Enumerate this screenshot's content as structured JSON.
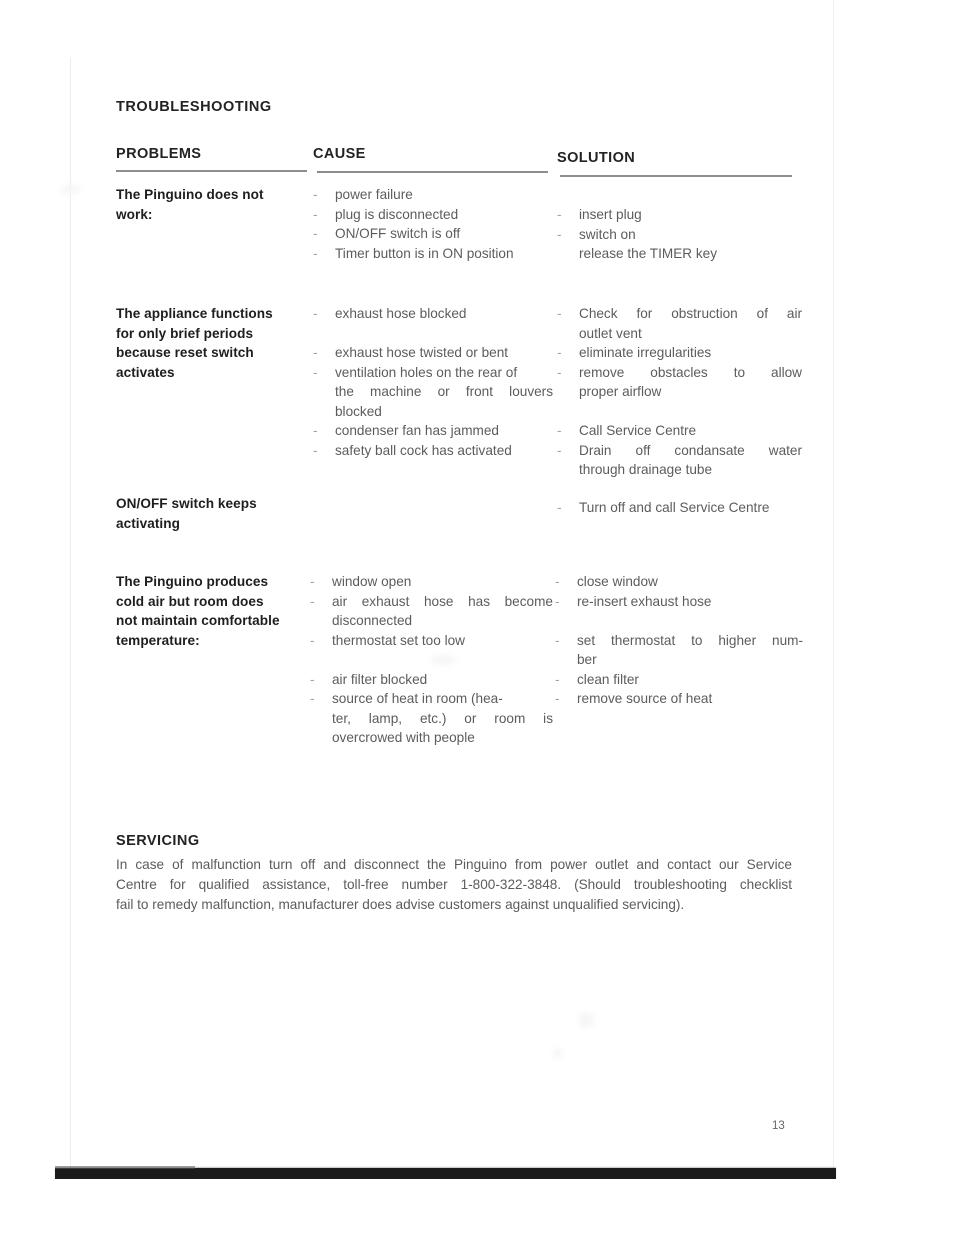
{
  "document": {
    "title": "TROUBLESHOOTING",
    "page_number": "13"
  },
  "table": {
    "headers": {
      "problems": "PROBLEMS",
      "cause": "CAUSE",
      "solution": "SOLUTION"
    },
    "rows": [
      {
        "problem": [
          "The Pinguino does not",
          "work:"
        ],
        "causes": [
          "power failure",
          "plug is disconnected",
          "ON/OFF switch is off",
          "Timer button is in ON position"
        ],
        "solutions": [
          "insert plug",
          "switch on",
          "release the TIMER key"
        ]
      },
      {
        "problem": [
          "The appliance functions",
          "for only brief periods",
          "because reset switch",
          "activates"
        ],
        "causes": [
          "exhaust hose blocked",
          "exhaust hose twisted or bent",
          "ventilation holes on the rear of",
          "the machine or front louvers",
          "blocked",
          "condenser fan has jammed",
          "safety ball cock has activated"
        ],
        "solutions": [
          "Check for obstruction of air",
          "outlet vent",
          "eliminate irregularities",
          "remove obstacles to allow",
          "proper airflow",
          "Call Service Centre",
          "Drain off condansate water",
          "through drainage tube"
        ]
      },
      {
        "problem": [
          "ON/OFF switch keeps",
          "activating"
        ],
        "causes": [],
        "solutions": [
          "Turn off and call Service Centre"
        ]
      },
      {
        "problem": [
          "The Pinguino produces",
          "cold air but room does",
          "not maintain comfortable",
          "temperature:"
        ],
        "causes": [
          "window open",
          "air exhaust hose has become",
          "disconnected",
          "thermostat set too low",
          "air filter blocked",
          "source of heat in room (hea-",
          "ter, lamp, etc.) or room is",
          "overcrowed with people"
        ],
        "solutions": [
          "close window",
          "re-insert exhaust hose",
          "set thermostat to higher num-",
          "ber",
          "clean filter",
          "remove source of heat"
        ]
      }
    ]
  },
  "servicing": {
    "title": "SERVICING",
    "lines": [
      "In case of malfunction turn off and disconnect the Pinguino from power outlet and contact our Service",
      "Centre for qualified assistance, toll-free number 1-800-322-3848. (Should troubleshooting checklist",
      "fail to remedy malfunction, manufacturer does advise customers against unqualified servicing)."
    ]
  },
  "symbols": {
    "dash": "-"
  }
}
